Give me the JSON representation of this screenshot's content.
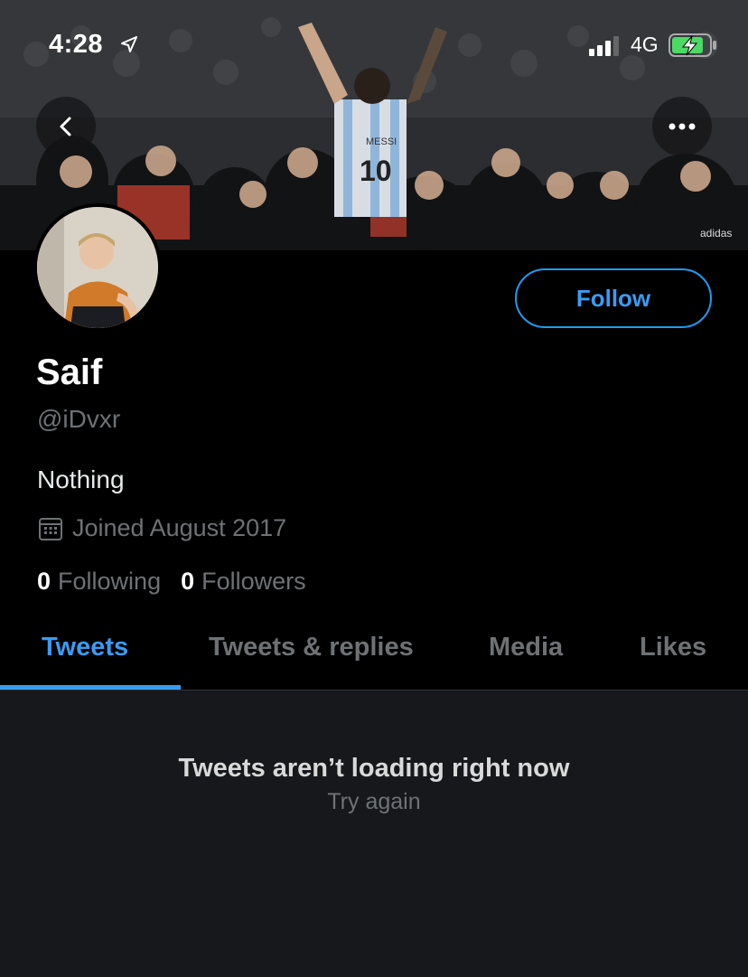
{
  "status_bar": {
    "time": "4:28",
    "network": "4G"
  },
  "header": {
    "back_icon": "chevron-left-icon",
    "more_icon": "more-horizontal-icon"
  },
  "profile": {
    "display_name": "Saif",
    "handle": "@iDvxr",
    "bio": "Nothing",
    "joined": "Joined August 2017",
    "follow_label": "Follow",
    "following_count": "0",
    "following_label": "Following",
    "followers_count": "0",
    "followers_label": "Followers"
  },
  "tabs": [
    {
      "label": "Tweets",
      "active": true
    },
    {
      "label": "Tweets & replies",
      "active": false
    },
    {
      "label": "Media",
      "active": false
    },
    {
      "label": "Likes",
      "active": false
    }
  ],
  "content": {
    "error_title": "Tweets aren’t loading right now",
    "retry_label": "Try again"
  },
  "colors": {
    "accent": "#1d9bf0",
    "background": "#000000",
    "muted_text": "#6e7275",
    "content_bg": "#16181c"
  }
}
